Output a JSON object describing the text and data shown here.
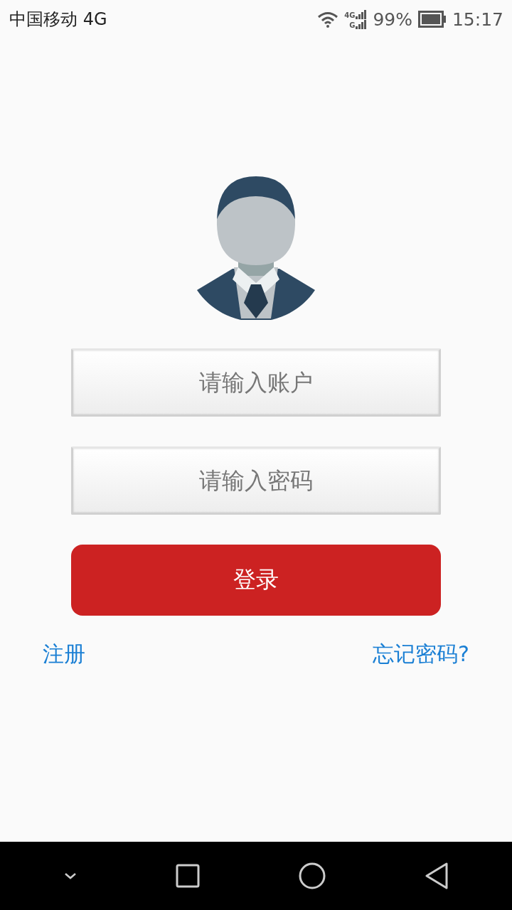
{
  "status_bar": {
    "carrier": "中国移动 4G",
    "signal_labels": [
      "4G",
      "G"
    ],
    "battery": "99%",
    "time": "15:17"
  },
  "login": {
    "account_field": {
      "placeholder": "请输入账户"
    },
    "password_field": {
      "placeholder": "请输入密码"
    },
    "login_button": "登录",
    "register_link": "注册",
    "forgot_password_link": "忘记密码?"
  },
  "nav_bar": {
    "buttons": [
      {
        "kind": "down"
      },
      {
        "kind": "square"
      },
      {
        "kind": "circle"
      },
      {
        "kind": "back"
      }
    ]
  }
}
